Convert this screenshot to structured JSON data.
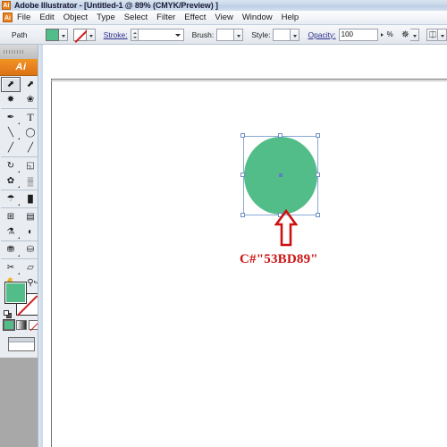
{
  "window": {
    "app_icon": "ai-logo-icon",
    "app_badge_text": "Ai",
    "title": "Adobe Illustrator - [Untitled-1 @ 89% (CMYK/Preview) ]"
  },
  "menubar": {
    "logo_text": "Ai",
    "items": [
      {
        "label": "File"
      },
      {
        "label": "Edit"
      },
      {
        "label": "Object"
      },
      {
        "label": "Type"
      },
      {
        "label": "Select"
      },
      {
        "label": "Filter"
      },
      {
        "label": "Effect"
      },
      {
        "label": "View"
      },
      {
        "label": "Window"
      },
      {
        "label": "Help"
      }
    ]
  },
  "options_bar": {
    "object_type_label": "Path",
    "fill_swatch_color": "#53bd89",
    "fill_dropdown_icon": "chevron-down-icon",
    "stroke_swatch_state": "none",
    "stroke_dropdown_icon": "chevron-down-icon",
    "stroke_label": "Stroke:",
    "stroke_weight_value": "",
    "brush_label": "Brush:",
    "brush_value": "",
    "style_label": "Style:",
    "style_value": "",
    "opacity_label": "Opacity:",
    "opacity_value": "100",
    "opacity_unit": "%",
    "transform_icon": "transform-effects-icon",
    "align_icon": "align-panel-icon"
  },
  "toolbox": {
    "header_text": "Ai",
    "grip_icon": "drag-grip-icon",
    "tools": [
      {
        "name": "selection-tool",
        "glyph": "⬈",
        "selected": true,
        "has_flyout": false
      },
      {
        "name": "direct-selection-tool",
        "glyph": "⬈",
        "selected": false,
        "has_flyout": true
      },
      {
        "name": "magic-wand-tool",
        "glyph": "✸",
        "selected": false,
        "has_flyout": false
      },
      {
        "name": "lasso-tool",
        "glyph": "❀",
        "selected": false,
        "has_flyout": false
      },
      {
        "name": "pen-tool",
        "glyph": "✒",
        "selected": false,
        "has_flyout": true
      },
      {
        "name": "type-tool",
        "glyph": "T",
        "selected": false,
        "has_flyout": true
      },
      {
        "name": "line-segment-tool",
        "glyph": "╲",
        "selected": false,
        "has_flyout": true
      },
      {
        "name": "ellipse-tool",
        "glyph": "◯",
        "selected": false,
        "has_flyout": true
      },
      {
        "name": "paintbrush-tool",
        "glyph": "╱",
        "selected": false,
        "has_flyout": false
      },
      {
        "name": "pencil-tool",
        "glyph": "╱",
        "selected": false,
        "has_flyout": true
      },
      {
        "name": "rotate-tool",
        "glyph": "↻",
        "selected": false,
        "has_flyout": true
      },
      {
        "name": "scale-tool",
        "glyph": "◱",
        "selected": false,
        "has_flyout": true
      },
      {
        "name": "warp-tool",
        "glyph": "✿",
        "selected": false,
        "has_flyout": true
      },
      {
        "name": "free-transform-tool",
        "glyph": "▒",
        "selected": false,
        "has_flyout": false
      },
      {
        "name": "symbol-sprayer-tool",
        "glyph": "☂",
        "selected": false,
        "has_flyout": true
      },
      {
        "name": "column-graph-tool",
        "glyph": "█",
        "selected": false,
        "has_flyout": true
      },
      {
        "name": "mesh-tool",
        "glyph": "⊞",
        "selected": false,
        "has_flyout": false
      },
      {
        "name": "gradient-tool",
        "glyph": "▤",
        "selected": false,
        "has_flyout": false
      },
      {
        "name": "eyedropper-tool",
        "glyph": "⚗",
        "selected": false,
        "has_flyout": true
      },
      {
        "name": "blend-tool",
        "glyph": "◐",
        "selected": false,
        "has_flyout": true
      },
      {
        "name": "live-paint-bucket-tool",
        "glyph": "⛃",
        "selected": false,
        "has_flyout": true
      },
      {
        "name": "live-paint-selection-tool",
        "glyph": "⛁",
        "selected": false,
        "has_flyout": false
      },
      {
        "name": "slice-tool",
        "glyph": "✂",
        "selected": false,
        "has_flyout": true
      },
      {
        "name": "eraser-tool",
        "glyph": "▱",
        "selected": false,
        "has_flyout": true
      },
      {
        "name": "hand-tool",
        "glyph": "✋",
        "selected": false,
        "has_flyout": true
      },
      {
        "name": "zoom-tool",
        "glyph": "⚲",
        "selected": false,
        "has_flyout": false
      }
    ],
    "fill_color": "#53bd89",
    "stroke_state": "none",
    "swap_icon": "swap-fill-stroke-icon",
    "default_icon": "default-fill-stroke-icon",
    "paint_modes": [
      {
        "name": "color-mode",
        "active": true
      },
      {
        "name": "gradient-mode",
        "active": false
      },
      {
        "name": "none-mode",
        "active": false
      }
    ],
    "screen_mode_icon": "screen-mode-icon"
  },
  "canvas": {
    "shape": {
      "name": "ellipse-shape",
      "fill_color": "#53bd89",
      "selected": true,
      "selection_handles": 8,
      "center_point_color": "#5a7fc4",
      "selection_border_color": "#8aa8d8"
    },
    "annotation": {
      "arrow_icon": "up-arrow-annotation-icon",
      "arrow_color": "#cc1111",
      "label": "C#\"53BD89\"",
      "label_color": "#cc1111"
    }
  }
}
